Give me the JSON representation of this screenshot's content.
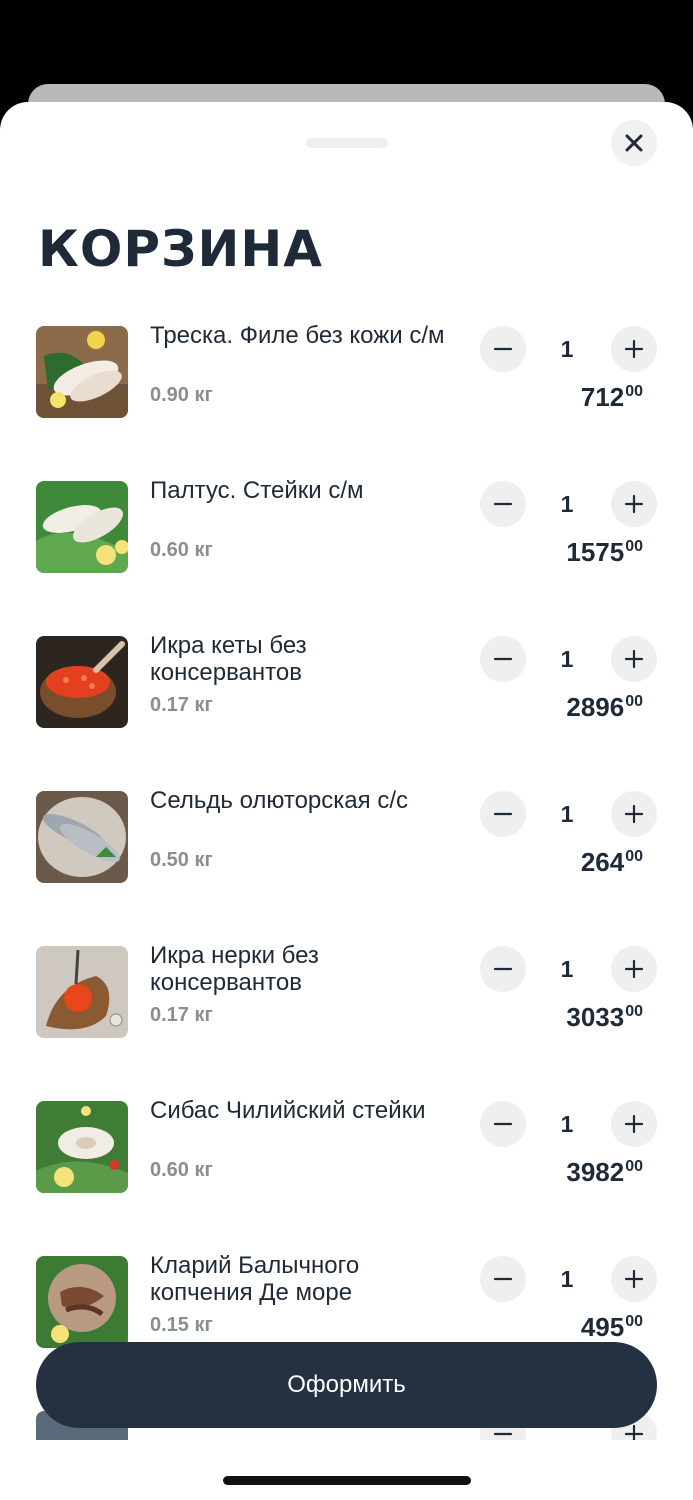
{
  "cart": {
    "title": "КОРЗИНА",
    "checkout_label": "Оформить",
    "items": [
      {
        "name": "Треска. Филе без кожи с/м",
        "weight": "0.90 кг",
        "qty": "1",
        "price_main": "712",
        "price_cents": "00",
        "thumb": "cod-fillet-icon"
      },
      {
        "name": "Палтус. Стейки с/м",
        "weight": "0.60 кг",
        "qty": "1",
        "price_main": "1575",
        "price_cents": "00",
        "thumb": "halibut-steak-icon"
      },
      {
        "name": "Икра кеты без консервантов",
        "weight": "0.17 кг",
        "qty": "1",
        "price_main": "2896",
        "price_cents": "00",
        "thumb": "chum-caviar-icon"
      },
      {
        "name": "Сельдь олюторская с/с",
        "weight": "0.50 кг",
        "qty": "1",
        "price_main": "264",
        "price_cents": "00",
        "thumb": "herring-icon"
      },
      {
        "name": "Икра нерки без консервантов",
        "weight": "0.17 кг",
        "qty": "1",
        "price_main": "3033",
        "price_cents": "00",
        "thumb": "sockeye-caviar-icon"
      },
      {
        "name": "Сибас Чилийский стейки",
        "weight": "0.60 кг",
        "qty": "1",
        "price_main": "3982",
        "price_cents": "00",
        "thumb": "seabass-steak-icon"
      },
      {
        "name": "Кларий Балычного копчения Де море",
        "weight": "0.15 кг",
        "qty": "1",
        "price_main": "495",
        "price_cents": "00",
        "thumb": "smoked-catfish-icon"
      }
    ]
  },
  "icons": {
    "close": "close-icon",
    "minus": "minus-icon",
    "plus": "plus-icon"
  },
  "colors": {
    "primary_dark": "#233140",
    "text_dark": "#1f2a38",
    "muted": "#8a8e93",
    "button_bg": "#efefef"
  }
}
